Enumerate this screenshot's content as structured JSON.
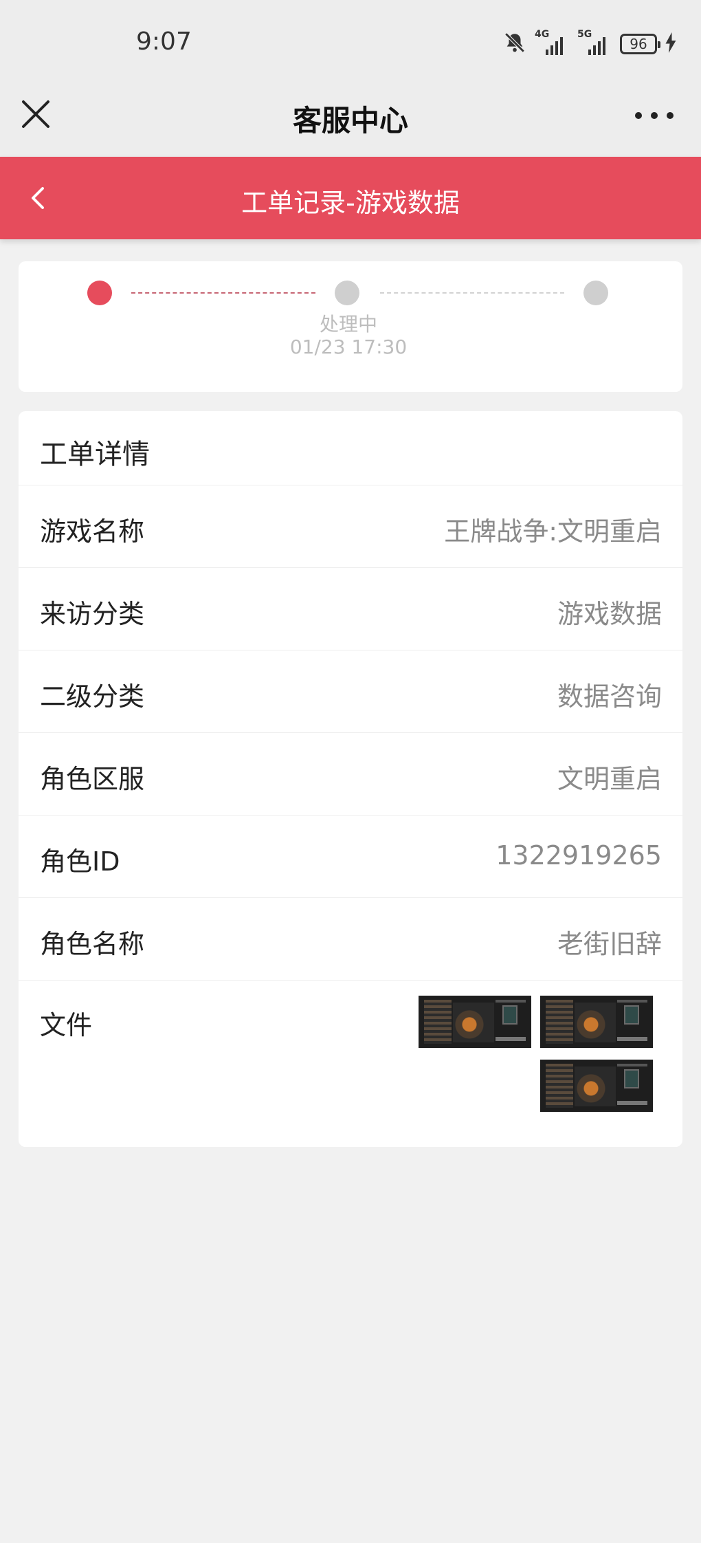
{
  "status_bar": {
    "time": "9:07",
    "net1": "4G",
    "net2": "5G",
    "battery": "96"
  },
  "titlebar": {
    "title": "客服中心"
  },
  "header": {
    "title": "工单记录-游戏数据"
  },
  "progress": {
    "current_step_label": "处理中",
    "current_step_time": "01/23 17:30"
  },
  "details": {
    "heading": "工单详情",
    "rows": [
      {
        "label": "游戏名称",
        "value": "王牌战争:文明重启"
      },
      {
        "label": "来访分类",
        "value": "游戏数据"
      },
      {
        "label": "二级分类",
        "value": "数据咨询"
      },
      {
        "label": "角色区服",
        "value": "文明重启"
      },
      {
        "label": "角色ID",
        "value": "1322919265"
      },
      {
        "label": "角色名称",
        "value": "老街旧辞"
      }
    ],
    "files_label": "文件"
  },
  "colors": {
    "accent": "#e64c5c",
    "background": "#f1f1f1",
    "secondary_text": "#8a8a8a"
  },
  "icons": {
    "close": "close-icon",
    "more": "more-icon",
    "back": "chevron-left-icon",
    "mute": "bell-off-icon"
  }
}
